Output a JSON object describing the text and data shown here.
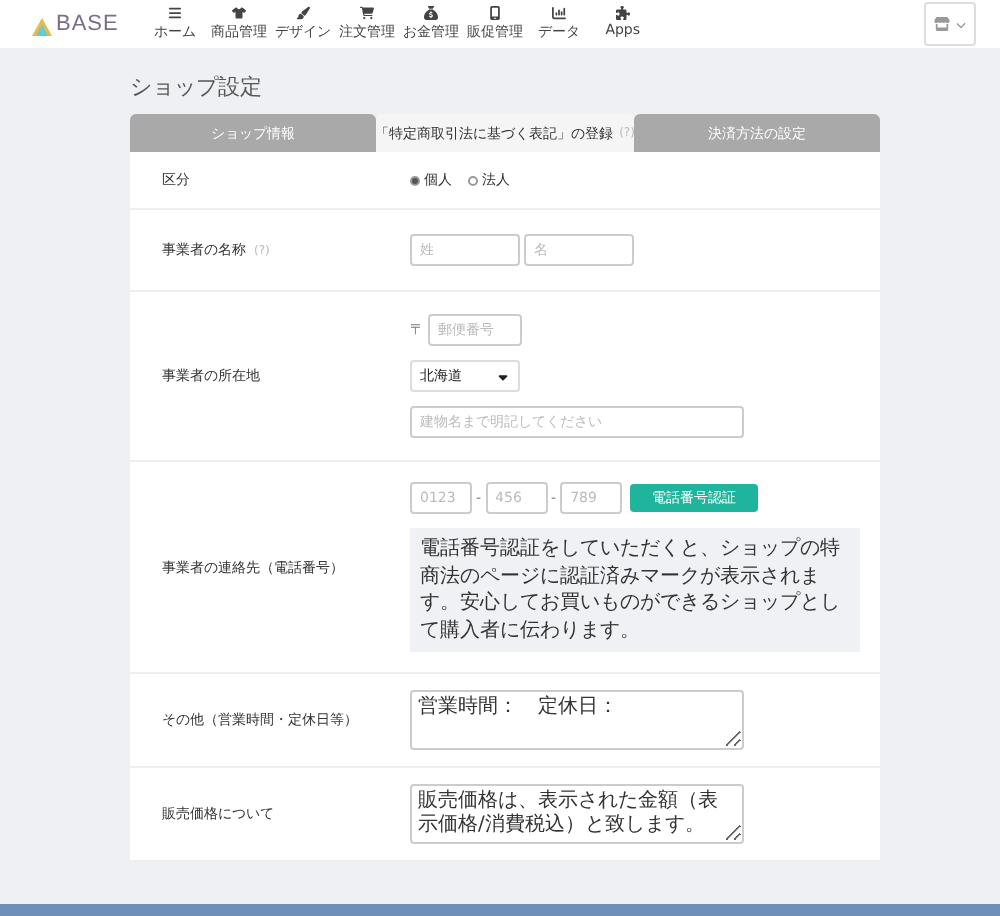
{
  "header": {
    "logo": "BASE",
    "nav": [
      {
        "label": "ホーム",
        "selected": false
      },
      {
        "label": "商品管理",
        "selected": false
      },
      {
        "label": "デザイン",
        "selected": false
      },
      {
        "label": "注文管理",
        "selected": false
      },
      {
        "label": "お金管理",
        "selected": false
      },
      {
        "label": "販促管理",
        "selected": false
      },
      {
        "label": "データ",
        "selected": false
      },
      {
        "label": "Apps",
        "selected": false
      }
    ]
  },
  "page_title": "ショップ設定",
  "tabs": [
    {
      "label": "ショップ情報",
      "selected": false
    },
    {
      "label": "「特定商取引法に基づく表記」の登録",
      "help": "(?)",
      "selected": true
    },
    {
      "label": "決済方法の設定",
      "selected": false
    }
  ],
  "rows": [
    {
      "kind": "radio",
      "label": "区分",
      "options": [
        {
          "label": "個人",
          "selected": true
        },
        {
          "label": "法人",
          "selected": false
        }
      ]
    },
    {
      "kind": "name",
      "label": "事業者の名称",
      "help": "(?)",
      "fields": [
        {
          "placeholder": "姓"
        },
        {
          "placeholder": "名"
        }
      ]
    },
    {
      "kind": "address",
      "label": "事業者の所在地",
      "postal_mark": "〒",
      "postal": {
        "placeholder": "郵便番号"
      },
      "prefecture": {
        "value": "北海道"
      },
      "street": {
        "placeholder": "建物名まで明記してください"
      }
    },
    {
      "kind": "phone",
      "label": "事業者の連絡先（電話番号）",
      "fields": [
        {
          "placeholder": "0123"
        },
        {
          "placeholder": "456"
        },
        {
          "placeholder": "789"
        }
      ],
      "separators": [
        "-",
        "-"
      ],
      "button": "電話番号認証",
      "note": "電話番号認証をしていただくと、ショップの特商法のページに認証済みマークが表示されます。安心してお買いものができるショップとして購入者に伝わります。"
    },
    {
      "kind": "textarea",
      "label": "その他（営業時間・定休日等）",
      "value": "営業時間：　定休日："
    },
    {
      "kind": "textarea",
      "label": "販売価格について",
      "value": "販売価格は、表示された金額（表示価格/消費税込）と致します。"
    }
  ]
}
